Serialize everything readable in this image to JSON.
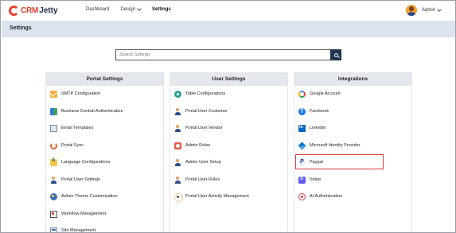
{
  "brand": {
    "crm": "CRM",
    "jetty": "Jetty"
  },
  "nav": {
    "dashboard": "Dashboard",
    "design": "Design",
    "settings": "Settings"
  },
  "user": {
    "name": "Admin"
  },
  "page": {
    "title": "Settings"
  },
  "search": {
    "placeholder": "Search Settings"
  },
  "panels": {
    "portal": {
      "title": "Portal Settings",
      "items": [
        {
          "label": "SMTP Configuration",
          "icon": "envelope-icon"
        },
        {
          "label": "Business Central Authentication",
          "icon": "business-central-icon"
        },
        {
          "label": "Email Templates",
          "icon": "email-template-icon"
        },
        {
          "label": "Portal Sync",
          "icon": "sync-icon"
        },
        {
          "label": "Language Configurations",
          "icon": "language-icon"
        },
        {
          "label": "Portal User Settings",
          "icon": "user-settings-icon"
        },
        {
          "label": "Admin Theme Customization",
          "icon": "palette-icon"
        },
        {
          "label": "Workflow Management",
          "icon": "workflow-icon"
        },
        {
          "label": "Site Management",
          "icon": "site-icon"
        }
      ]
    },
    "user": {
      "title": "User Settings",
      "items": [
        {
          "label": "Table Configurations",
          "icon": "table-config-icon"
        },
        {
          "label": "Portal User Customer",
          "icon": "user-customer-icon"
        },
        {
          "label": "Portal User Vendor",
          "icon": "user-vendor-icon"
        },
        {
          "label": "Admin Roles",
          "icon": "admin-roles-icon"
        },
        {
          "label": "Admin User Setup",
          "icon": "admin-user-icon"
        },
        {
          "label": "Portal User Roles",
          "icon": "user-roles-icon"
        },
        {
          "label": "Portal User Activity Management",
          "icon": "activity-icon"
        }
      ]
    },
    "integrations": {
      "title": "Integrations",
      "items": [
        {
          "label": "Google Account",
          "icon": "google-icon"
        },
        {
          "label": "Facebook",
          "icon": "facebook-icon"
        },
        {
          "label": "Linkedin",
          "icon": "linkedin-icon"
        },
        {
          "label": "Microsoft Identity Provider",
          "icon": "microsoft-icon"
        },
        {
          "label": "Paypal",
          "icon": "paypal-icon"
        },
        {
          "label": "Stripe",
          "icon": "stripe-icon"
        },
        {
          "label": "AI Authentication",
          "icon": "ai-auth-icon"
        }
      ]
    }
  },
  "colors": {
    "accent": "#e8412c",
    "header_bar": "#dbe3ee",
    "search_button": "#1f3550",
    "highlight": "#d63b3b"
  }
}
